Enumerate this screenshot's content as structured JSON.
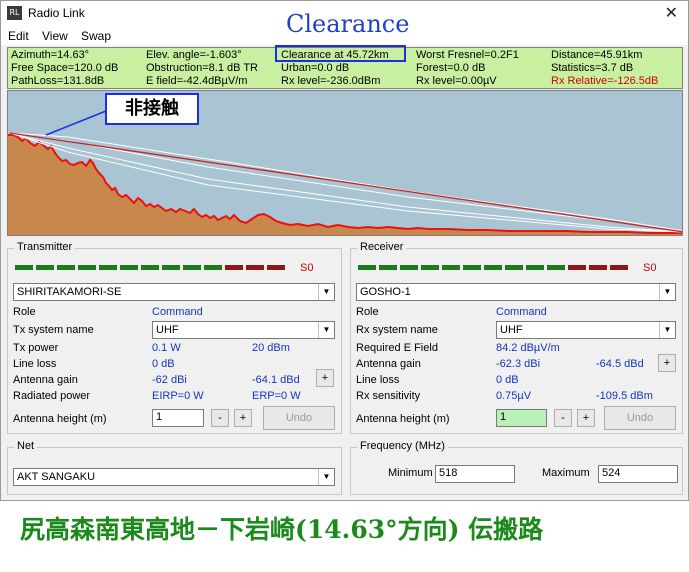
{
  "window": {
    "title": "Radio Link",
    "icon": "RL",
    "close_glyph": "✕"
  },
  "menu": [
    "Edit",
    "View",
    "Swap"
  ],
  "overlay": {
    "clearance_title": "Clearance",
    "no_contact_label": "非接触"
  },
  "info": {
    "row1": [
      "Azimuth=14.63°",
      "Elev. angle=-1.603°",
      "Clearance at 45.72km",
      "Worst Fresnel=0.2F1",
      "Distance=45.91km"
    ],
    "row2": [
      "Free Space=120.0 dB",
      "Obstruction=8.1 dB TR",
      "Urban=0.0 dB",
      "Forest=0.0 dB",
      "Statistics=3.7 dB"
    ],
    "row3": [
      "PathLoss=131.8dB",
      "E field=-42.4dBµV/m",
      "Rx level=-236.0dBm",
      "Rx level=0.00µV",
      "Rx Relative=-126.5dB"
    ]
  },
  "colors": {
    "terrain_fill": "#c8884c",
    "terrain_line": "#ee1010",
    "sky": "#a9c4d2",
    "info_bg": "#c8f0a0",
    "highlight_box": "#1c2ee0",
    "caption": "#1a8a1a",
    "rx_relative": "#d40000"
  },
  "transmitter": {
    "title": "Transmitter",
    "meter_label": "S0",
    "site": "SHIRITAKAMORI-SE",
    "role_label": "Role",
    "role_value": "Command",
    "system_label": "Tx system name",
    "system_value": "UHF",
    "power_label": "Tx power",
    "power_w": "0.1 W",
    "power_dbm": "20 dBm",
    "line_loss_label": "Line loss",
    "line_loss_value": "0 dB",
    "gain_label": "Antenna gain",
    "gain_dbi": "-62 dBi",
    "gain_dbd": "-64.1 dBd",
    "radiated_label": "Radiated power",
    "eirp": "EIRP=0 W",
    "erp": "ERP=0 W",
    "height_label": "Antenna height (m)",
    "height_value": "1",
    "undo_label": "Undo"
  },
  "receiver": {
    "title": "Receiver",
    "meter_label": "S0",
    "site": "GOSHO-1",
    "role_label": "Role",
    "role_value": "Command",
    "system_label": "Rx system name",
    "system_value": "UHF",
    "field_label": "Required E Field",
    "field_value": "84.2 dBµV/m",
    "gain_label": "Antenna gain",
    "gain_dbi": "-62.3 dBi",
    "gain_dbd": "-64.5 dBd",
    "line_loss_label": "Line loss",
    "line_loss_value": "0 dB",
    "sens_label": "Rx sensitivity",
    "sens_uv": "0.75µV",
    "sens_dbm": "-109.5 dBm",
    "height_label": "Antenna height (m)",
    "height_value": "1",
    "undo_label": "Undo"
  },
  "net": {
    "title": "Net",
    "value": "AKT SANGAKU"
  },
  "frequency": {
    "title": "Frequency (MHz)",
    "min_label": "Minimum",
    "min_value": "518",
    "max_label": "Maximum",
    "max_value": "524"
  },
  "caption": "尻高森南東高地－下岩崎(14.63°方向) 伝搬路"
}
